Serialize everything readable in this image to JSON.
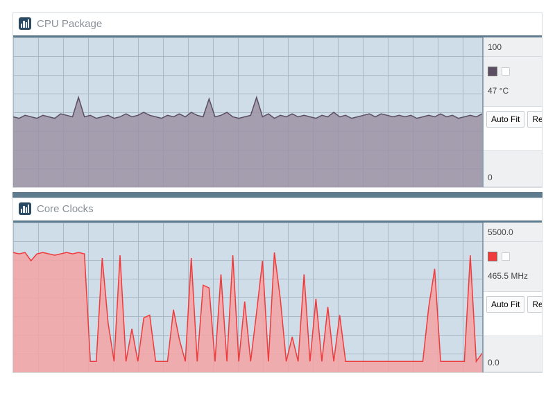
{
  "panels": [
    {
      "title": "CPU Package",
      "color": "#5b4e63",
      "fill": "#9c93a5",
      "ymax_label": "100",
      "ymin_label": "0",
      "legend_value": "47 °C",
      "autofit_label": "Auto Fit",
      "reset_label": "Re",
      "chart_key": "cpu"
    },
    {
      "title": "Core Clocks",
      "color": "#ef3b3b",
      "fill": "#f5a3a3",
      "ymax_label": "5500.0",
      "ymin_label": "0.0",
      "legend_value": "465.5 MHz",
      "autofit_label": "Auto Fit",
      "reset_label": "Re",
      "chart_key": "clocks"
    }
  ],
  "chart_data": [
    {
      "type": "area",
      "title": "CPU Package",
      "xlabel": "",
      "ylabel": "°C",
      "ylim": [
        0,
        100
      ],
      "x": [
        0,
        1,
        2,
        3,
        4,
        5,
        6,
        7,
        8,
        9,
        10,
        11,
        12,
        13,
        14,
        15,
        16,
        17,
        18,
        19,
        20,
        21,
        22,
        23,
        24,
        25,
        26,
        27,
        28,
        29,
        30,
        31,
        32,
        33,
        34,
        35,
        36,
        37,
        38,
        39,
        40,
        41,
        42,
        43,
        44,
        45,
        46,
        47,
        48,
        49,
        50,
        51,
        52,
        53,
        54,
        55,
        56,
        57,
        58,
        59,
        60,
        61,
        62,
        63,
        64,
        65,
        66,
        67,
        68,
        69,
        70,
        71,
        72,
        73,
        74,
        75,
        76,
        77,
        78,
        79
      ],
      "values": [
        47,
        46,
        48,
        47,
        46,
        48,
        47,
        46,
        49,
        48,
        47,
        60,
        47,
        48,
        46,
        47,
        48,
        46,
        47,
        49,
        47,
        48,
        50,
        48,
        47,
        46,
        48,
        47,
        49,
        47,
        50,
        48,
        47,
        59,
        47,
        48,
        50,
        47,
        46,
        47,
        48,
        60,
        47,
        49,
        46,
        48,
        47,
        49,
        47,
        48,
        47,
        46,
        48,
        47,
        50,
        47,
        48,
        46,
        47,
        48,
        49,
        47,
        49,
        48,
        47,
        48,
        47,
        48,
        46,
        47,
        48,
        47,
        49,
        47,
        48,
        46,
        47,
        48,
        47,
        49
      ]
    },
    {
      "type": "area",
      "title": "Core Clocks",
      "xlabel": "",
      "ylabel": "MHz",
      "ylim": [
        0,
        5500
      ],
      "x": [
        0,
        1,
        2,
        3,
        4,
        5,
        6,
        7,
        8,
        9,
        10,
        11,
        12,
        13,
        14,
        15,
        16,
        17,
        18,
        19,
        20,
        21,
        22,
        23,
        24,
        25,
        26,
        27,
        28,
        29,
        30,
        31,
        32,
        33,
        34,
        35,
        36,
        37,
        38,
        39,
        40,
        41,
        42,
        43,
        44,
        45,
        46,
        47,
        48,
        49,
        50,
        51,
        52,
        53,
        54,
        55,
        56,
        57,
        58,
        59,
        60,
        61,
        62,
        63,
        64,
        65,
        66,
        67,
        68,
        69,
        70,
        71,
        72,
        73,
        74,
        75,
        76,
        77,
        78,
        79
      ],
      "values": [
        4400,
        4350,
        4400,
        4100,
        4350,
        4400,
        4350,
        4300,
        4350,
        4400,
        4350,
        4400,
        4350,
        400,
        400,
        4200,
        1800,
        400,
        4300,
        400,
        1600,
        400,
        2000,
        2100,
        400,
        400,
        400,
        2300,
        1200,
        400,
        4200,
        400,
        3200,
        3100,
        400,
        3600,
        400,
        4300,
        400,
        2600,
        400,
        2200,
        4100,
        400,
        4400,
        2700,
        400,
        1300,
        400,
        3600,
        400,
        2700,
        400,
        2400,
        400,
        2100,
        400,
        400,
        400,
        400,
        400,
        400,
        400,
        400,
        400,
        400,
        400,
        400,
        400,
        400,
        2400,
        3800,
        400,
        400,
        400,
        400,
        400,
        4300,
        400,
        700
      ]
    }
  ]
}
